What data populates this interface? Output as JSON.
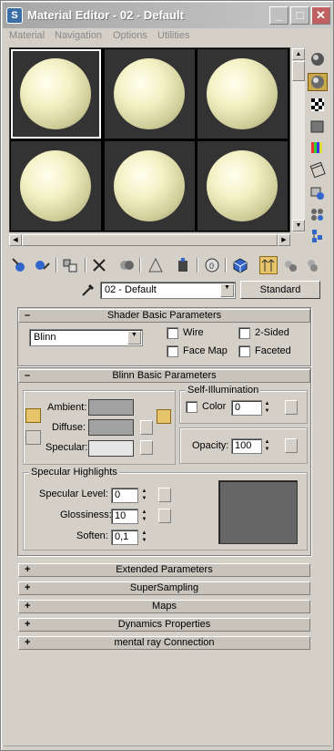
{
  "window": {
    "title": "Material Editor - 02 - Default",
    "app_icon": "3ds-max-icon",
    "controls": {
      "minimize": "_",
      "maximize": "□",
      "close": "✕"
    }
  },
  "menu": [
    "Material",
    "Navigation",
    "Options",
    "Utilities"
  ],
  "sample_slots": {
    "count": 6,
    "active_index": 0
  },
  "material": {
    "name": "02 - Default",
    "type_button": "Standard"
  },
  "shader_basic": {
    "header": "Shader Basic Parameters",
    "toggle": "–",
    "shader": "Blinn",
    "wire": "Wire",
    "two_sided": "2-Sided",
    "face_map": "Face Map",
    "faceted": "Faceted"
  },
  "blinn_basic": {
    "header": "Blinn Basic Parameters",
    "toggle": "–",
    "ambient": "Ambient:",
    "diffuse": "Diffuse:",
    "specular": "Specular:",
    "self_illum_title": "Self-Illumination",
    "color_label": "Color",
    "color_value": "0",
    "opacity_label": "Opacity:",
    "opacity_value": "100",
    "colors": {
      "ambient": "#a2a2a2",
      "diffuse": "#a2a2a2",
      "specular": "#e6e6e6"
    }
  },
  "specular_highlights": {
    "title": "Specular Highlights",
    "level_label": "Specular Level:",
    "level_value": "0",
    "gloss_label": "Glossiness:",
    "gloss_value": "10",
    "soften_label": "Soften:",
    "soften_value": "0,1"
  },
  "collapsed_rollouts": [
    {
      "toggle": "+",
      "label": "Extended Parameters"
    },
    {
      "toggle": "+",
      "label": "SuperSampling"
    },
    {
      "toggle": "+",
      "label": "Maps"
    },
    {
      "toggle": "+",
      "label": "Dynamics Properties"
    },
    {
      "toggle": "+",
      "label": "mental ray Connection"
    }
  ]
}
